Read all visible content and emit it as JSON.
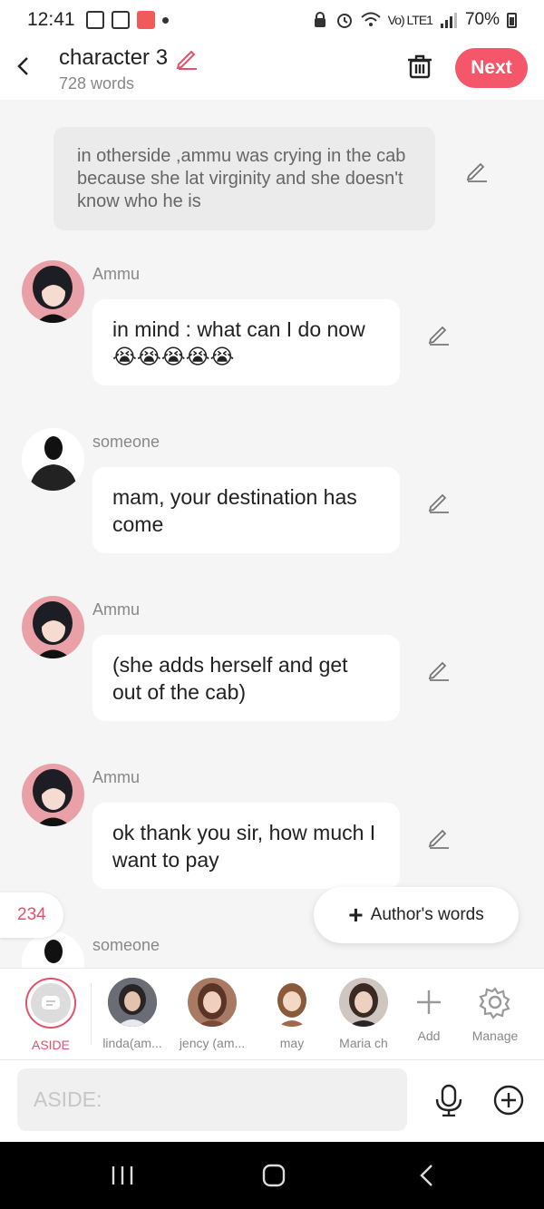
{
  "status_bar": {
    "time": "12:41",
    "network": "Vo) LTE1",
    "battery": "70%"
  },
  "header": {
    "title": "character 3",
    "word_count": "728 words",
    "next_label": "Next"
  },
  "narration": {
    "text": "in otherside ,ammu was crying in the cab because she lat virginity and she doesn't know who he is"
  },
  "messages": [
    {
      "name": "Ammu",
      "avatar": "girl-avatar",
      "text": "in mind : what can I do now 😭😭😭😭😭"
    },
    {
      "name": "someone",
      "avatar": "silhouette-avatar",
      "text": "mam, your destination has come"
    },
    {
      "name": "Ammu",
      "avatar": "girl-avatar",
      "text": "(she adds herself and get out of the cab)"
    },
    {
      "name": "Ammu",
      "avatar": "girl-avatar",
      "text": "ok thank you sir, how much I want to pay"
    },
    {
      "name": "someone",
      "avatar": "silhouette-avatar",
      "text": ""
    }
  ],
  "counter": "234",
  "authors_words_label": "Author's words",
  "characters": [
    {
      "label": "ASIDE",
      "icon": "aside-chat-icon"
    },
    {
      "label": "linda(am...",
      "icon": "avatar"
    },
    {
      "label": "jency (am...",
      "icon": "avatar"
    },
    {
      "label": "may",
      "icon": "avatar"
    },
    {
      "label": "Maria ch",
      "icon": "avatar"
    },
    {
      "label": "Add",
      "icon": "plus-icon"
    },
    {
      "label": "Manage",
      "icon": "gear-icon"
    }
  ],
  "input": {
    "placeholder": "ASIDE:"
  },
  "colors": {
    "accent": "#f4566a",
    "accent_text": "#e4516a",
    "background": "#f5f5f5"
  }
}
